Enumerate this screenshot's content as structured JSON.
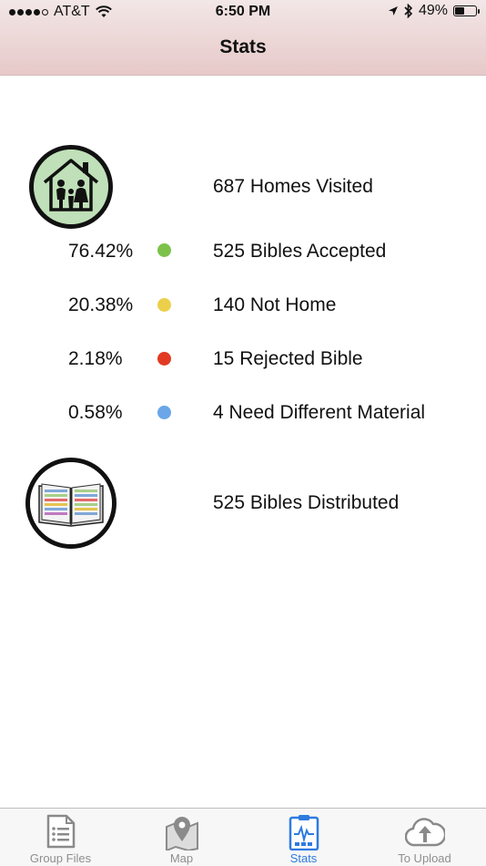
{
  "status_bar": {
    "carrier": "AT&T",
    "time": "6:50 PM",
    "battery": "49%",
    "battery_level": 0.49
  },
  "nav": {
    "title": "Stats"
  },
  "stats": {
    "homes_visited": "687 Homes Visited",
    "breakdown": [
      {
        "percent": "76.42%",
        "label": "525 Bibles Accepted",
        "color": "#7cc24a"
      },
      {
        "percent": "20.38%",
        "label": "140 Not Home",
        "color": "#ecd04a"
      },
      {
        "percent": "2.18%",
        "label": "15 Rejected Bible",
        "color": "#e23a22"
      },
      {
        "percent": "0.58%",
        "label": "4 Need Different Material",
        "color": "#6aa6e8"
      }
    ],
    "bibles_distributed": "525 Bibles Distributed"
  },
  "tabbar": {
    "tabs": [
      {
        "label": "Group Files",
        "icon": "document-list-icon"
      },
      {
        "label": "Map",
        "icon": "map-pin-icon"
      },
      {
        "label": "Stats",
        "icon": "stats-clipboard-icon",
        "active": true
      },
      {
        "label": "To Upload",
        "icon": "cloud-upload-icon"
      }
    ],
    "active_color": "#2f7be0"
  }
}
